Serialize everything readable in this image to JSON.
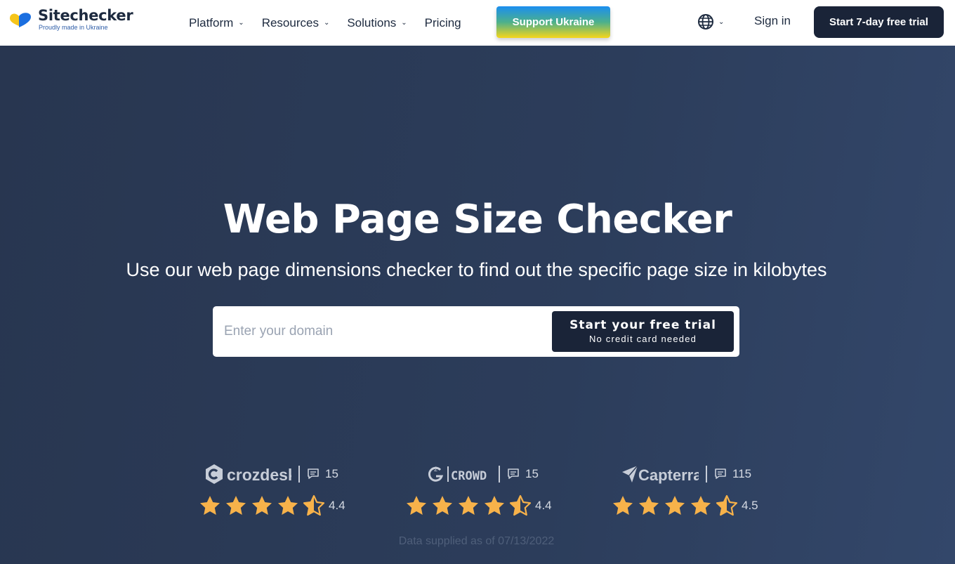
{
  "brand": {
    "name": "Sitechecker",
    "tagline": "Proudly made in Ukraine"
  },
  "nav": {
    "items": [
      {
        "label": "Platform",
        "dropdown": true
      },
      {
        "label": "Resources",
        "dropdown": true
      },
      {
        "label": "Solutions",
        "dropdown": true
      },
      {
        "label": "Pricing",
        "dropdown": false
      }
    ],
    "ukraine_label": "Support Ukraine",
    "language_icon": "globe-icon",
    "sign_in": "Sign in",
    "trial_label": "Start 7-day free trial"
  },
  "hero": {
    "title": "Web Page Size Checker",
    "subtitle": "Use our web page dimensions checker to find out the specific page size in kilobytes",
    "input_placeholder": "Enter your domain",
    "input_value": "",
    "cta_main": "Start your free trial",
    "cta_sub": "No credit card needed"
  },
  "reviews": [
    {
      "platform": "crozdesk",
      "count": "15",
      "rating": "4.4",
      "rating_value": 4.4,
      "icon": "crozdesk-logo-icon"
    },
    {
      "platform": "CROWD",
      "count": "15",
      "rating": "4.4",
      "rating_value": 4.4,
      "icon": "g2-crowd-logo-icon"
    },
    {
      "platform": "Capterra",
      "count": "115",
      "rating": "4.5",
      "rating_value": 4.5,
      "icon": "capterra-logo-icon"
    }
  ],
  "footnote": "Data supplied as of 07/13/2022",
  "colors": {
    "navy": "#1a2438",
    "hero_bg": "#2b3a55",
    "star": "#f7b24a",
    "ukraine_blue": "#1b8ef0",
    "ukraine_yellow": "#f6d61a"
  }
}
